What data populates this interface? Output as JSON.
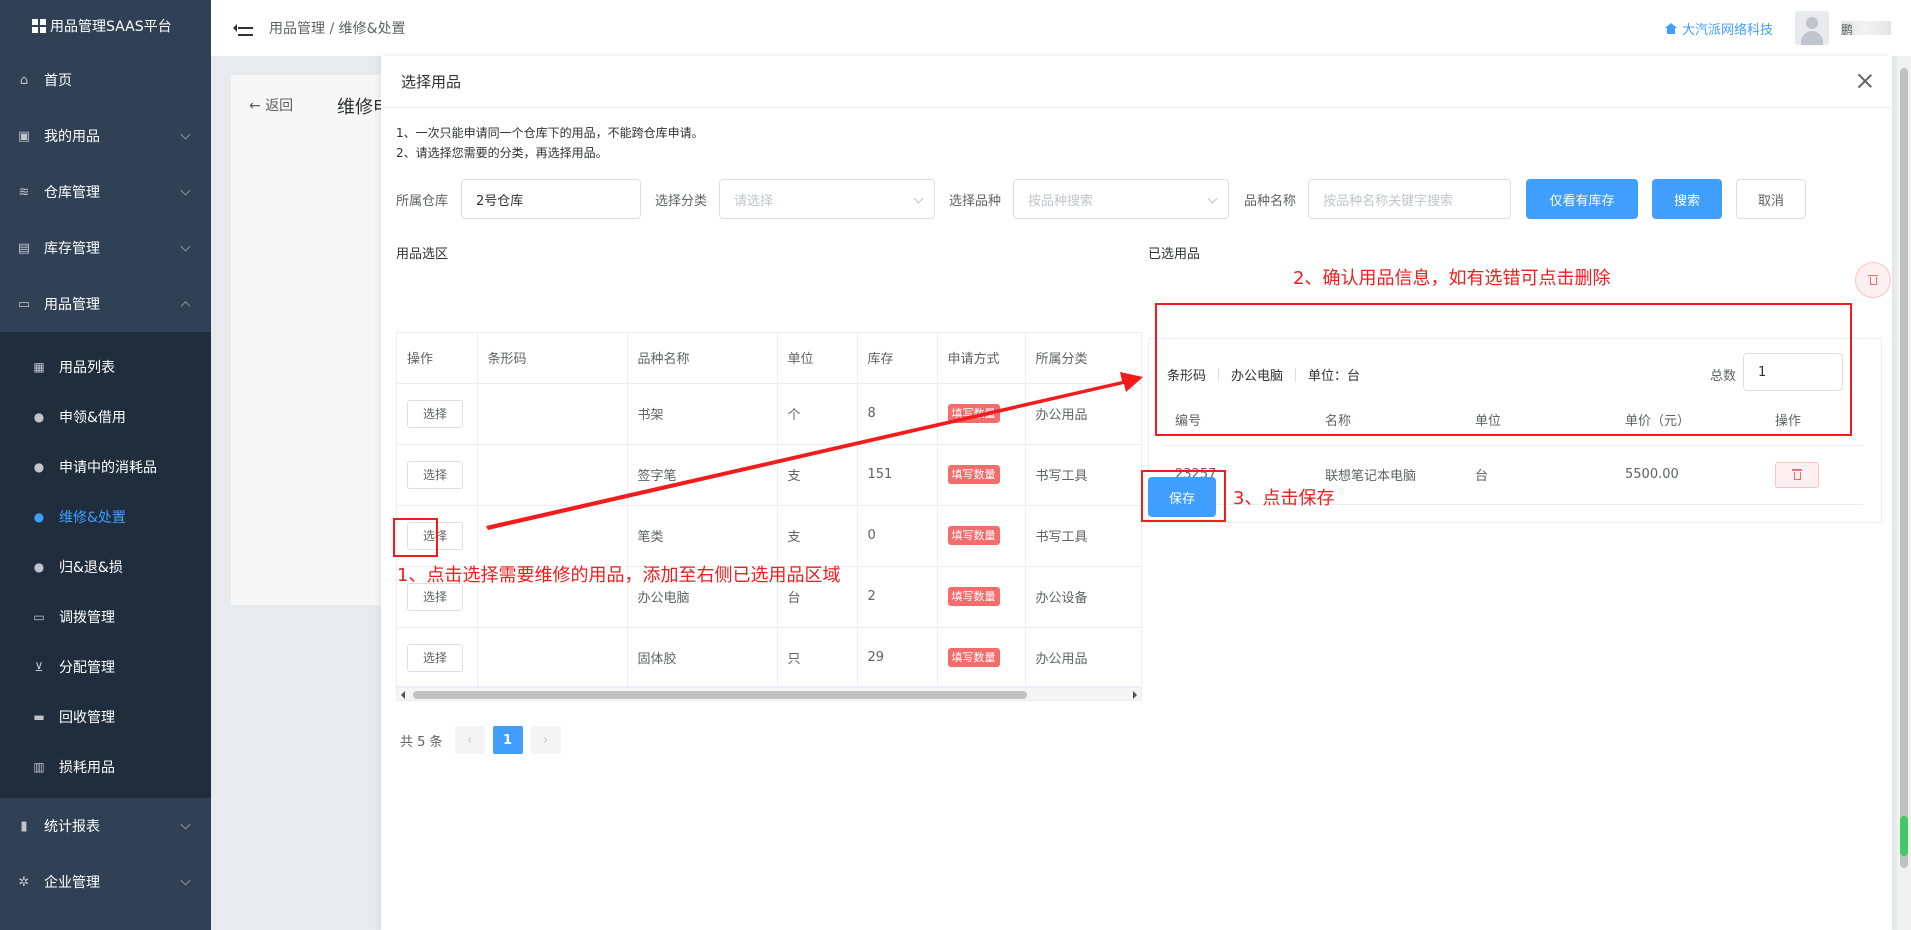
{
  "brand": "用品管理SAAS平台",
  "sidebar": {
    "items": [
      {
        "label": "首页",
        "icon": "home-icon"
      },
      {
        "label": "我的用品",
        "icon": "bag-icon"
      },
      {
        "label": "仓库管理",
        "icon": "database-icon"
      },
      {
        "label": "库存管理",
        "icon": "box-icon"
      },
      {
        "label": "用品管理",
        "icon": "inbox-icon"
      }
    ],
    "sub_items": [
      {
        "label": "用品列表",
        "icon": "list-icon"
      },
      {
        "label": "申领&借用",
        "icon": "user-icon"
      },
      {
        "label": "申请中的消耗品",
        "icon": "user-icon"
      },
      {
        "label": "维修&处置",
        "icon": "user-icon"
      },
      {
        "label": "归&退&损",
        "icon": "user-icon"
      },
      {
        "label": "调拨管理",
        "icon": "truck-icon"
      },
      {
        "label": "分配管理",
        "icon": "cart-icon"
      },
      {
        "label": "回收管理",
        "icon": "recycle-icon"
      },
      {
        "label": "损耗用品",
        "icon": "trash-icon"
      }
    ],
    "bottom_items": [
      {
        "label": "统计报表",
        "icon": "chart-icon"
      },
      {
        "label": "企业管理",
        "icon": "gear-icon"
      }
    ]
  },
  "topbar": {
    "breadcrumb": "用品管理 / 维修&处置",
    "company": "大汽派网络科技",
    "username": "鹏"
  },
  "background_page": {
    "back_label": "返回",
    "title": "维修申"
  },
  "modal": {
    "title": "选择用品",
    "notes": [
      "1、一次只能申请同一个仓库下的用品，不能跨仓库申请。",
      "2、请选择您需要的分类，再选择用品。"
    ],
    "filters": {
      "warehouse_label": "所属仓库",
      "warehouse_value": "2号仓库",
      "category_label": "选择分类",
      "category_placeholder": "请选择",
      "variety_label": "选择品种",
      "variety_placeholder": "按品种搜索",
      "name_label": "品种名称",
      "name_placeholder": "按品种名称关键字搜索",
      "stock_only_button": "仅看有库存",
      "search_button": "搜索",
      "cancel_button": "取消"
    },
    "left_section_label": "用品选区",
    "left_table": {
      "headers": [
        "操作",
        "条形码",
        "品种名称",
        "单位",
        "库存",
        "申请方式",
        "所属分类"
      ],
      "select_label": "选择",
      "rows": [
        {
          "name": "书架",
          "unit": "个",
          "stock": "8",
          "method": "填写数量",
          "category": "办公用品"
        },
        {
          "name": "签字笔",
          "unit": "支",
          "stock": "151",
          "method": "填写数量",
          "category": "书写工具"
        },
        {
          "name": "笔类",
          "unit": "支",
          "stock": "0",
          "method": "填写数量",
          "category": "书写工具"
        },
        {
          "name": "办公电脑",
          "unit": "台",
          "stock": "2",
          "method": "填写数量",
          "category": "办公设备"
        },
        {
          "name": "固体胶",
          "unit": "只",
          "stock": "29",
          "method": "填写数量",
          "category": "办公用品"
        }
      ]
    },
    "pager": {
      "total": "共 5 条",
      "current": "1",
      "prev": "‹",
      "next": "›"
    },
    "right_section_label": "已选用品",
    "selected": {
      "barcode_label": "条形码",
      "item_name": "办公电脑",
      "unit_label": "单位：台",
      "total_label": "总数",
      "total_value": "1",
      "headers": [
        "编号",
        "名称",
        "单位",
        "单价（元）",
        "操作"
      ],
      "rows": [
        {
          "id": "23257",
          "name": "联想笔记本电脑",
          "unit": "台",
          "price": "5500.00"
        }
      ]
    },
    "save_button": "保存"
  },
  "annotations": {
    "step1": "1、点击选择需要维修的用品，添加至右侧已选用品区域",
    "step2": "2、确认用品信息，如有选错可点击删除",
    "step3": "3、点击保存",
    "color": "#f21c1c"
  },
  "colors": {
    "primary": "#409eff",
    "danger": "#f56c6c",
    "sidebar": "#304156"
  }
}
